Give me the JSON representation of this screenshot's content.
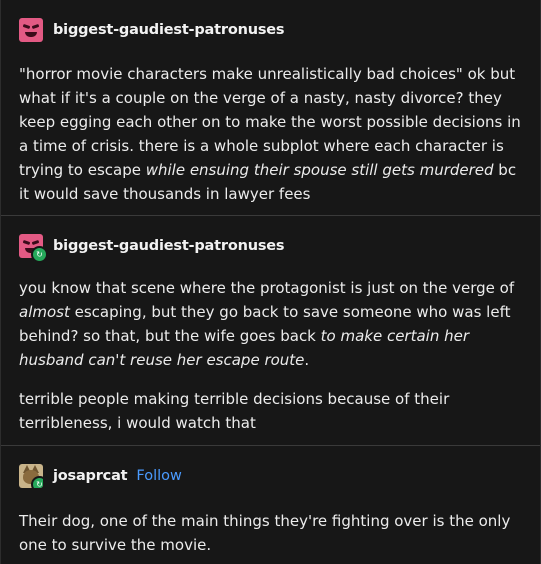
{
  "posts": [
    {
      "username": "biggest-gaudiest-patronuses",
      "avatar": "pink-face-avatar",
      "reblogged": false,
      "paragraphs": [
        [
          {
            "t": "\"horror movie characters make unrealistically bad choices\" ok but what if it's a couple on the verge of a nasty, nasty divorce? they keep egging each other on to make the worst possible decisions in a time of crisis. there is a whole subplot where each character is trying to escape ",
            "i": false
          },
          {
            "t": "while ensuing their spouse still gets murdered",
            "i": true
          },
          {
            "t": " bc it would save thousands in lawyer fees",
            "i": false
          }
        ]
      ]
    },
    {
      "username": "biggest-gaudiest-patronuses",
      "avatar": "pink-face-avatar",
      "reblogged": true,
      "paragraphs": [
        [
          {
            "t": "you know that scene where the protagonist is just on the verge of ",
            "i": false
          },
          {
            "t": "almost",
            "i": true
          },
          {
            "t": " escaping, but they go back to save someone who was left behind? so that, but the wife goes back ",
            "i": false
          },
          {
            "t": "to make certain her husband can't reuse her escape route",
            "i": true
          },
          {
            "t": ".",
            "i": false
          }
        ],
        [
          {
            "t": "terrible people making terrible decisions because of their terribleness, i would watch that",
            "i": false
          }
        ]
      ]
    },
    {
      "username": "josaprcat",
      "follow_label": "Follow",
      "avatar": "cat-avatar",
      "reblogged": true,
      "paragraphs": [
        [
          {
            "t": "Their dog, one of the main things they're fighting over is the only one to survive the movie.",
            "i": false
          }
        ]
      ]
    }
  ],
  "colors": {
    "background": "#171717",
    "text": "#ececec",
    "follow": "#4a9bff",
    "reblog_badge": "#26a95b",
    "avatar_pink": "#e35a84"
  }
}
